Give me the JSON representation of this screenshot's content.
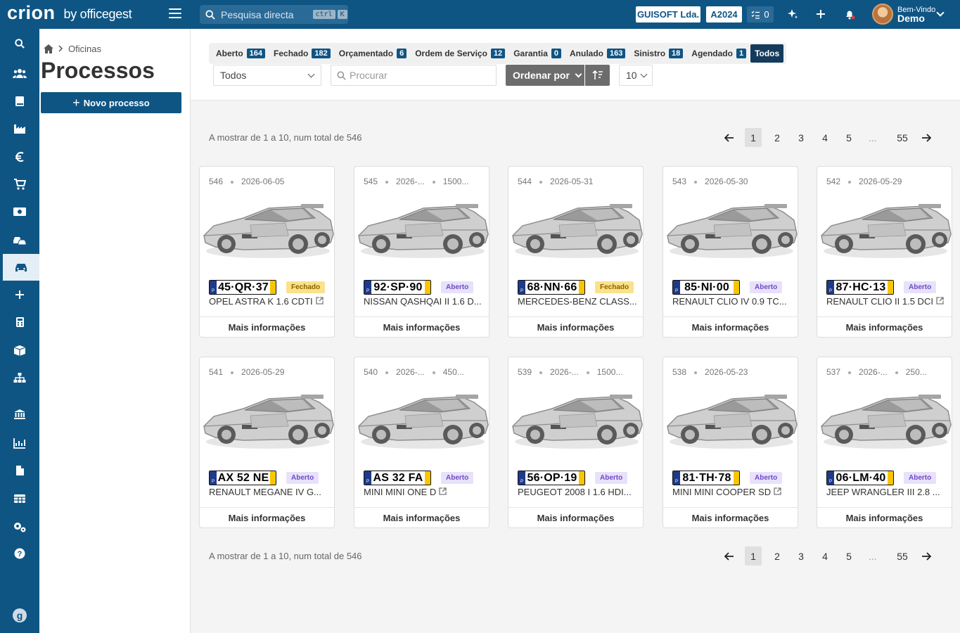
{
  "app": {
    "logo_main": "crion",
    "logo_by": "by officegest"
  },
  "topbar": {
    "search_placeholder": "Pesquisa directa",
    "kbd1": "ctrl",
    "kbd2": "K",
    "company": "GUISOFT Lda.",
    "year": "A2024",
    "todo_count": "0",
    "welcome_small": "Bem-Vindo",
    "user_name": "Demo"
  },
  "breadcrumb": {
    "section": "Oficinas"
  },
  "page": {
    "title": "Processos",
    "new_button": "Novo processo"
  },
  "tabs": [
    {
      "label": "Aberto",
      "count": "164"
    },
    {
      "label": "Fechado",
      "count": "182"
    },
    {
      "label": "Orçamentado",
      "count": "6"
    },
    {
      "label": "Ordem de Serviço",
      "count": "12"
    },
    {
      "label": "Garantia",
      "count": "0"
    },
    {
      "label": "Anulado",
      "count": "163"
    },
    {
      "label": "Sinistro",
      "count": "18"
    },
    {
      "label": "Agendado",
      "count": "1"
    }
  ],
  "tab_all": "Todos",
  "filters": {
    "status_select": "Todos",
    "search_placeholder": "Procurar",
    "sort_label": "Ordenar por",
    "per_page": "10"
  },
  "pagination": {
    "info": "A mostrar de 1 a 10, num total de 546",
    "pages": [
      "1",
      "2",
      "3",
      "4",
      "5",
      "...",
      "55"
    ],
    "current": "1"
  },
  "card_more_label": "Mais informações",
  "cards": [
    {
      "id": "546",
      "date": "2026-06-05",
      "extra": "",
      "plate": "45·QR·37",
      "status": "Fechado",
      "model": "OPEL ASTRA K 1.6 CDTI"
    },
    {
      "id": "545",
      "date": "2026-...",
      "extra": "1500...",
      "plate": "92·SP·90",
      "status": "Aberto",
      "model": "NISSAN QASHQAI II 1.6 D..."
    },
    {
      "id": "544",
      "date": "2026-05-31",
      "extra": "",
      "plate": "68·NN·66",
      "status": "Fechado",
      "model": "MERCEDES-BENZ CLASS..."
    },
    {
      "id": "543",
      "date": "2026-05-30",
      "extra": "",
      "plate": "85·NI·00",
      "status": "Aberto",
      "model": "RENAULT CLIO IV 0.9 TC..."
    },
    {
      "id": "542",
      "date": "2026-05-29",
      "extra": "",
      "plate": "87·HC·13",
      "status": "Aberto",
      "model": "RENAULT CLIO II 1.5 DCI"
    },
    {
      "id": "541",
      "date": "2026-05-29",
      "extra": "",
      "plate": "AX 52 NE",
      "status": "Aberto",
      "model": "RENAULT MEGANE IV G..."
    },
    {
      "id": "540",
      "date": "2026-...",
      "extra": "450...",
      "plate": "AS 32 FA",
      "status": "Aberto",
      "model": "MINI MINI ONE D"
    },
    {
      "id": "539",
      "date": "2026-...",
      "extra": "1500...",
      "plate": "56·OP·19",
      "status": "Aberto",
      "model": "PEUGEOT 2008 I 1.6 HDI..."
    },
    {
      "id": "538",
      "date": "2026-05-23",
      "extra": "",
      "plate": "81·TH·78",
      "status": "Aberto",
      "model": "MINI MINI COOPER SD"
    },
    {
      "id": "537",
      "date": "2026-...",
      "extra": "250...",
      "plate": "06·LM·40",
      "status": "Aberto",
      "model": "JEEP WRANGLER III 2.8 ..."
    }
  ],
  "sidebar_icons": [
    "search-icon",
    "users-icon",
    "book-icon",
    "factory-icon",
    "euro-icon",
    "cart-icon",
    "cash-icon",
    "vehicles-icon",
    "car-icon",
    "plus-icon",
    "calculator-icon",
    "box-icon",
    "org-chart-icon",
    "bank-icon",
    "chart-icon",
    "document-icon",
    "table-icon",
    "settings-icon",
    "help-icon",
    "logo-g-icon"
  ],
  "colors": {
    "primary": "#0f5584",
    "closed_badge": "#fbe28a",
    "open_badge": "#e8e1fb"
  }
}
